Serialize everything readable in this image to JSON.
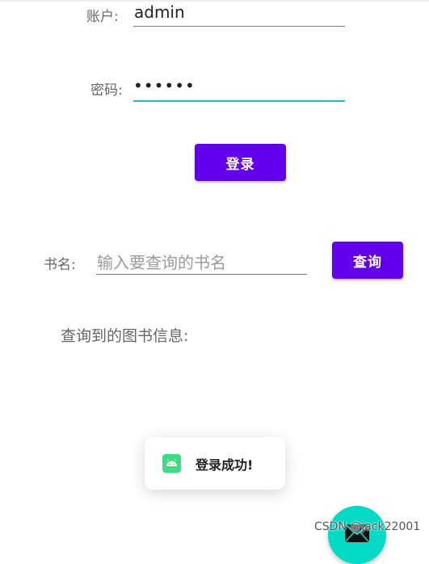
{
  "login": {
    "account_label": "账户:",
    "account_value": "admin",
    "password_label": "密码:",
    "password_value": "••••••",
    "login_button": "登录"
  },
  "search": {
    "book_label": "书名:",
    "book_placeholder": "输入要查询的书名",
    "query_button": "查询"
  },
  "results": {
    "label": "查询到的图书信息:"
  },
  "toast": {
    "message": "登录成功!",
    "icon": "android-icon"
  },
  "fab": {
    "icon": "email-icon"
  },
  "watermark": {
    "text": "CSDN @jack22001"
  },
  "colors": {
    "primary": "#6200ee",
    "secondary": "#03dac5",
    "focus_underline": "#1fc4b6",
    "android_green": "#3ddc84"
  }
}
